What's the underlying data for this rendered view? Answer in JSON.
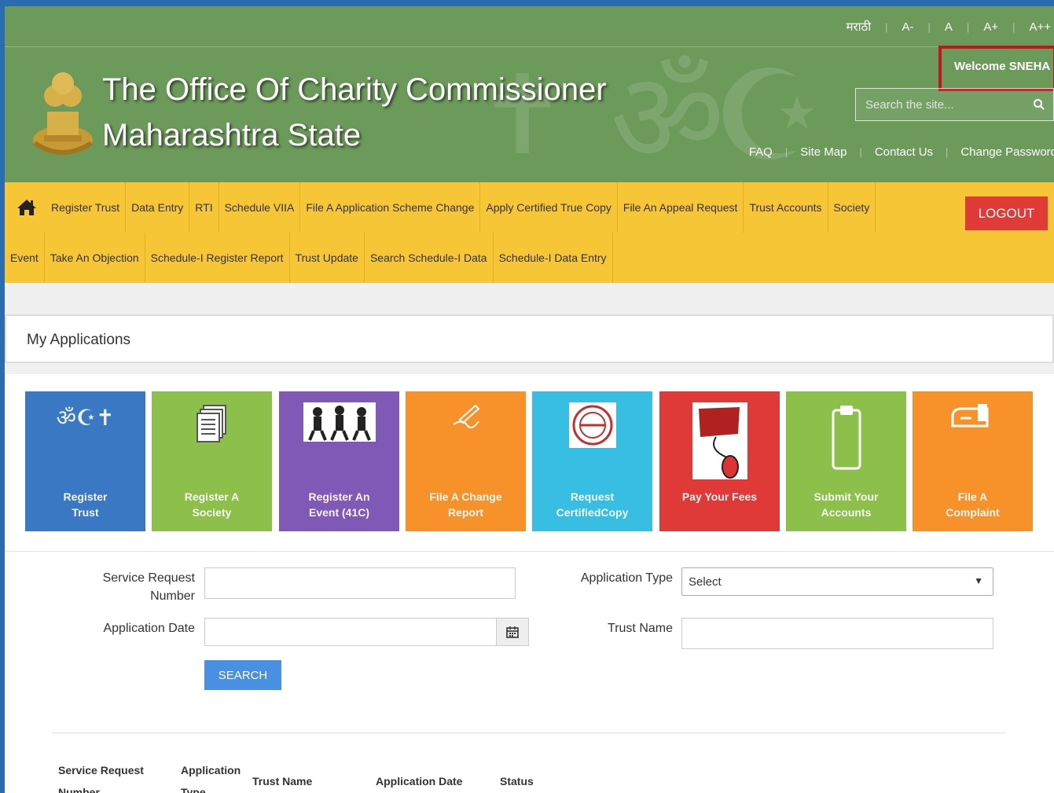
{
  "header": {
    "languages": [
      "मराठी",
      "A-",
      "A",
      "A+",
      "A++"
    ],
    "title_line1": "The Office Of Charity Commissioner",
    "title_line2": "Maharashtra State",
    "welcome": "Welcome SNEHA",
    "search_placeholder": "Search the site...",
    "links": [
      "FAQ",
      "Site Map",
      "Contact Us",
      "Change Password"
    ]
  },
  "nav": {
    "row1": [
      "Register Trust",
      "Data Entry",
      "RTI",
      "Schedule VIIA",
      "File A Application Scheme Change",
      "Apply Certified True Copy",
      "File An Appeal Request",
      "Trust Accounts",
      "Society"
    ],
    "row2": [
      "Event",
      "Take An Objection",
      "Schedule-I Register Report",
      "Trust Update",
      "Search Schedule-I Data",
      "Schedule-I Data Entry"
    ],
    "logout": "LOGOUT"
  },
  "section_title": "My Applications",
  "tiles": [
    {
      "line1": "Register",
      "line2": "Trust",
      "color": "#3b78c4",
      "icon": "religion-symbols-icon"
    },
    {
      "line1": "Register A",
      "line2": "Society",
      "color": "#8cc04a",
      "icon": "documents-icon"
    },
    {
      "line1": "Register An",
      "line2": "Event (41C)",
      "color": "#8059b6",
      "icon": "people-event-icon"
    },
    {
      "line1": "File A Change",
      "line2": "Report",
      "color": "#f7922a",
      "icon": "pen-writing-icon"
    },
    {
      "line1": "Request",
      "line2": "CertifiedCopy",
      "color": "#38bde3",
      "icon": "certified-stamp-icon"
    },
    {
      "line1": "Pay Your Fees",
      "line2": "",
      "color": "#df3a37",
      "icon": "pay-mouse-icon"
    },
    {
      "line1": "Submit Your",
      "line2": "Accounts",
      "color": "#8cc04a",
      "icon": "clipboard-icon"
    },
    {
      "line1": "File A",
      "line2": "Complaint",
      "color": "#f7922a",
      "icon": "mailbox-icon"
    }
  ],
  "form": {
    "service_request_label_1": "Service Request",
    "service_request_label_2": "Number",
    "application_date_label": "Application Date",
    "application_type_label": "Application Type",
    "application_type_value": "Select",
    "trust_name_label": "Trust Name",
    "search_button": "SEARCH"
  },
  "table": {
    "headers": [
      {
        "line1": "Service Request",
        "line2": "Number"
      },
      {
        "line1": "Application",
        "line2": "Type"
      },
      {
        "line1": "Trust Name",
        "line2": ""
      },
      {
        "line1": "Application Date",
        "line2": ""
      },
      {
        "line1": "Status",
        "line2": ""
      }
    ]
  }
}
